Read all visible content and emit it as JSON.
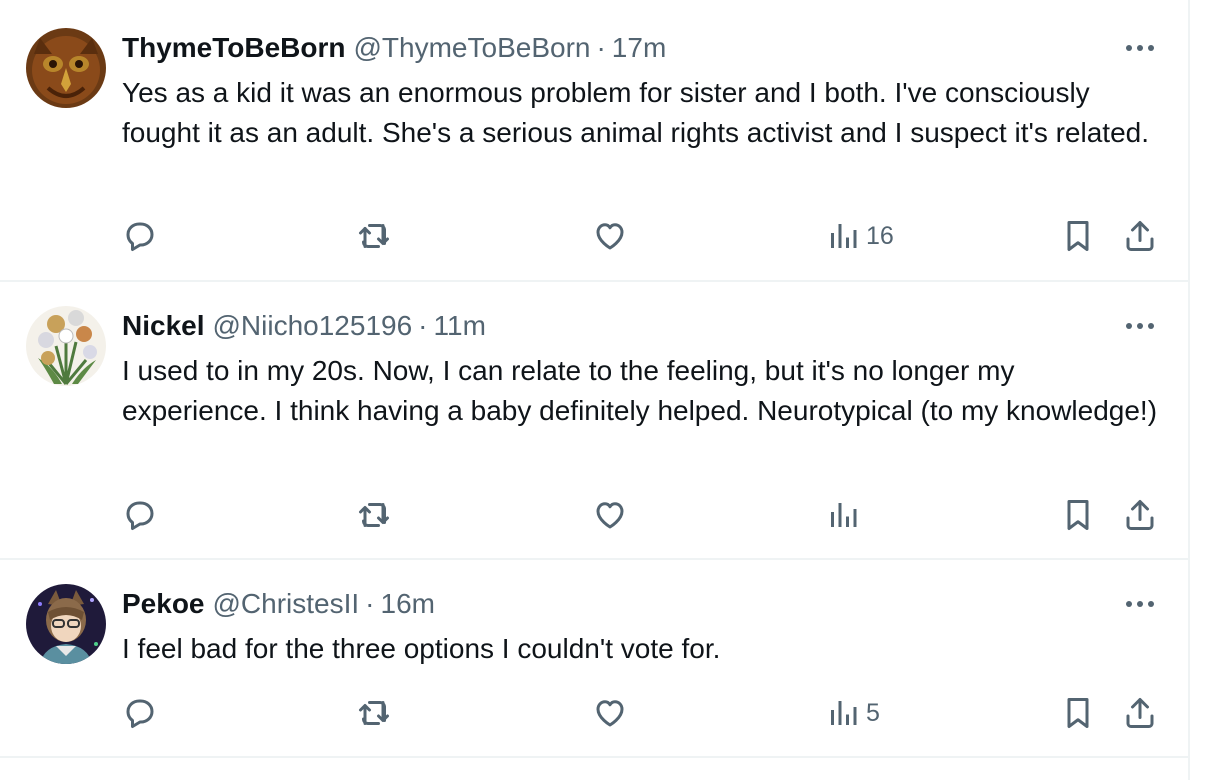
{
  "tweets": [
    {
      "name": "ThymeToBeBorn",
      "handle": "@ThymeToBeBorn",
      "separator": "·",
      "time": "17m",
      "text": "Yes as a kid it was an enormous problem for sister and I both. I've consciously fought it as an adult. She's a serious animal rights activist and I suspect it's related.",
      "views": "16"
    },
    {
      "name": "Nickel",
      "handle": "@Niicho125196",
      "separator": "·",
      "time": "11m",
      "text": "I used to in my 20s. Now, I can relate to the feeling, but it's no longer my experience. I think having a baby definitely helped. Neurotypical (to my knowledge!)",
      "views": ""
    },
    {
      "name": "Pekoe",
      "handle": "@ChristesII",
      "separator": "·",
      "time": "16m",
      "text": "I feel bad for the three options I couldn't vote for.",
      "views": "5"
    }
  ],
  "icons": {
    "reply": "reply-icon",
    "retweet": "retweet-icon",
    "like": "like-icon",
    "views": "views-icon",
    "bookmark": "bookmark-icon",
    "share": "share-icon",
    "more": "more-icon"
  },
  "colors": {
    "text": "#0f1419",
    "secondary": "#536471",
    "divider": "#eff3f4"
  }
}
